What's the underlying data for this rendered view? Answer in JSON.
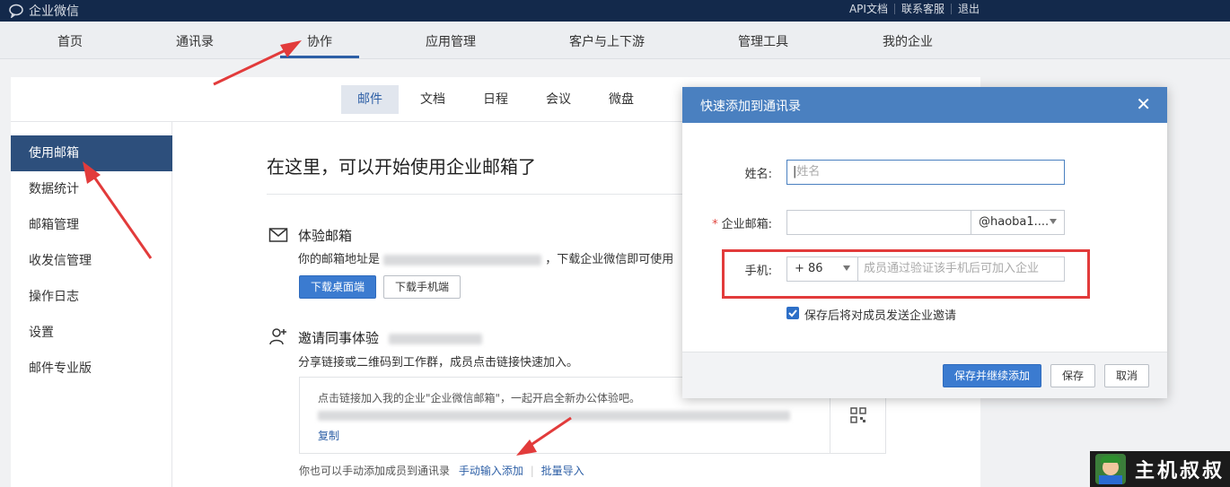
{
  "topbar": {
    "logo_text": "企业微信",
    "links": [
      "API文档",
      "联系客服",
      "退出"
    ]
  },
  "mainnav": {
    "items": [
      "首页",
      "通讯录",
      "协作",
      "应用管理",
      "客户与上下游",
      "管理工具",
      "我的企业"
    ],
    "active": "协作"
  },
  "subtabs": {
    "items": [
      "邮件",
      "文档",
      "日程",
      "会议",
      "微盘"
    ],
    "active": "邮件"
  },
  "sidebar": {
    "items": [
      "使用邮箱",
      "数据统计",
      "邮箱管理",
      "收发信管理",
      "操作日志",
      "设置",
      "邮件专业版"
    ],
    "active": "使用邮箱"
  },
  "main": {
    "heading": "在这里，可以开始使用企业邮箱了",
    "trial": {
      "title": "体验邮箱",
      "text_prefix": "你的邮箱地址是",
      "text_suffix": "，下载企业微信即可使用",
      "btn_desktop": "下载桌面端",
      "btn_mobile": "下载手机端"
    },
    "invite": {
      "title": "邀请同事体验",
      "desc": "分享链接或二维码到工作群，成员点击链接快速加入。",
      "box_line1": "点击链接加入我的企业\"企业微信邮箱\"，一起开启全新办公体验吧。",
      "copy": "复制",
      "footer_text": "你也可以手动添加成员到通讯录",
      "manual_add": "手动输入添加",
      "batch_import": "批量导入"
    }
  },
  "modal": {
    "title": "快速添加到通讯录",
    "close": "✕",
    "name_label": "姓名:",
    "name_placeholder": "姓名",
    "email_label": "企业邮箱:",
    "email_domain": "@haoba1....",
    "phone_label": "手机:",
    "phone_code": "+ 86",
    "phone_placeholder": "成员通过验证该手机后可加入企业",
    "checkbox_label": "保存后将对成员发送企业邀请",
    "btn_save_continue": "保存并继续添加",
    "btn_save": "保存",
    "btn_cancel": "取消"
  },
  "watermark": {
    "text": "主机叔叔"
  },
  "colors": {
    "topbar": "#13294b",
    "accent": "#2d5fa6",
    "modal_header": "#4a80c0",
    "annotation_red": "#e23b3b"
  }
}
